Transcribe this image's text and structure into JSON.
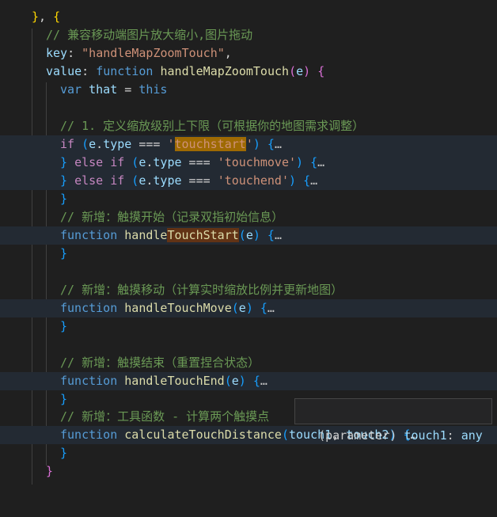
{
  "editor": {
    "lines": {
      "l1": [
        "}",
        ", ",
        "{"
      ],
      "l2": "// 兼容移动端图片放大缩小,图片拖动",
      "l3": [
        "key",
        ": ",
        "\"handleMapZoomTouch\"",
        ","
      ],
      "l4": [
        "value",
        ": ",
        "function",
        " ",
        "handleMapZoomTouch",
        "(",
        "e",
        ") ",
        "{"
      ],
      "l5": [
        "var",
        " ",
        "that",
        " = ",
        "this"
      ],
      "l7": "// 1. 定义缩放级别上下限（可根据你的地图需求调整）",
      "l8": [
        "if",
        " (",
        "e",
        ".",
        "type",
        " === ",
        "'",
        "touchstart",
        "'",
        ") ",
        "{",
        "…"
      ],
      "l9": [
        "}",
        " ",
        "else",
        " ",
        "if",
        " (",
        "e",
        ".",
        "type",
        " === ",
        "'touchmove'",
        ") ",
        "{",
        "…"
      ],
      "l10": [
        "}",
        " ",
        "else",
        " ",
        "if",
        " (",
        "e",
        ".",
        "type",
        " === ",
        "'touchend'",
        ") ",
        "{",
        "…"
      ],
      "l11": "}",
      "l12": "// 新增：触摸开始（记录双指初始信息）",
      "l13": [
        "function",
        " ",
        "handle",
        "TouchStart",
        "(",
        "e",
        ") ",
        "{",
        "…"
      ],
      "l14": "}",
      "l16": "// 新增：触摸移动（计算实时缩放比例并更新地图）",
      "l17": [
        "function",
        " ",
        "handleTouchMove",
        "(",
        "e",
        ") ",
        "{",
        "…"
      ],
      "l18": "}",
      "l20": "// 新增：触摸结束（重置捏合状态）",
      "l21": [
        "function",
        " ",
        "handleTouchEnd",
        "(",
        "e",
        ") ",
        "{",
        "…"
      ],
      "l22": "}",
      "l23": "// 新增：工具函数 - 计算两个触摸点",
      "l24": [
        "function",
        " ",
        "calculateTouchDistance",
        "(",
        "touch1",
        ", ",
        "touch2",
        ") ",
        "{",
        "…"
      ],
      "l25": "}",
      "l26": "}"
    }
  },
  "hover_tooltip": {
    "kind": "(parameter)",
    "name": "touch1",
    "sep": ": ",
    "type": "any"
  },
  "colors": {
    "background": "#1f1f1f",
    "keyword": "#569cd6",
    "function_name": "#dcdcaa",
    "variable": "#9cdcfe",
    "string": "#ce9178",
    "comment": "#6a9955",
    "find_match": "#9e6a03"
  }
}
